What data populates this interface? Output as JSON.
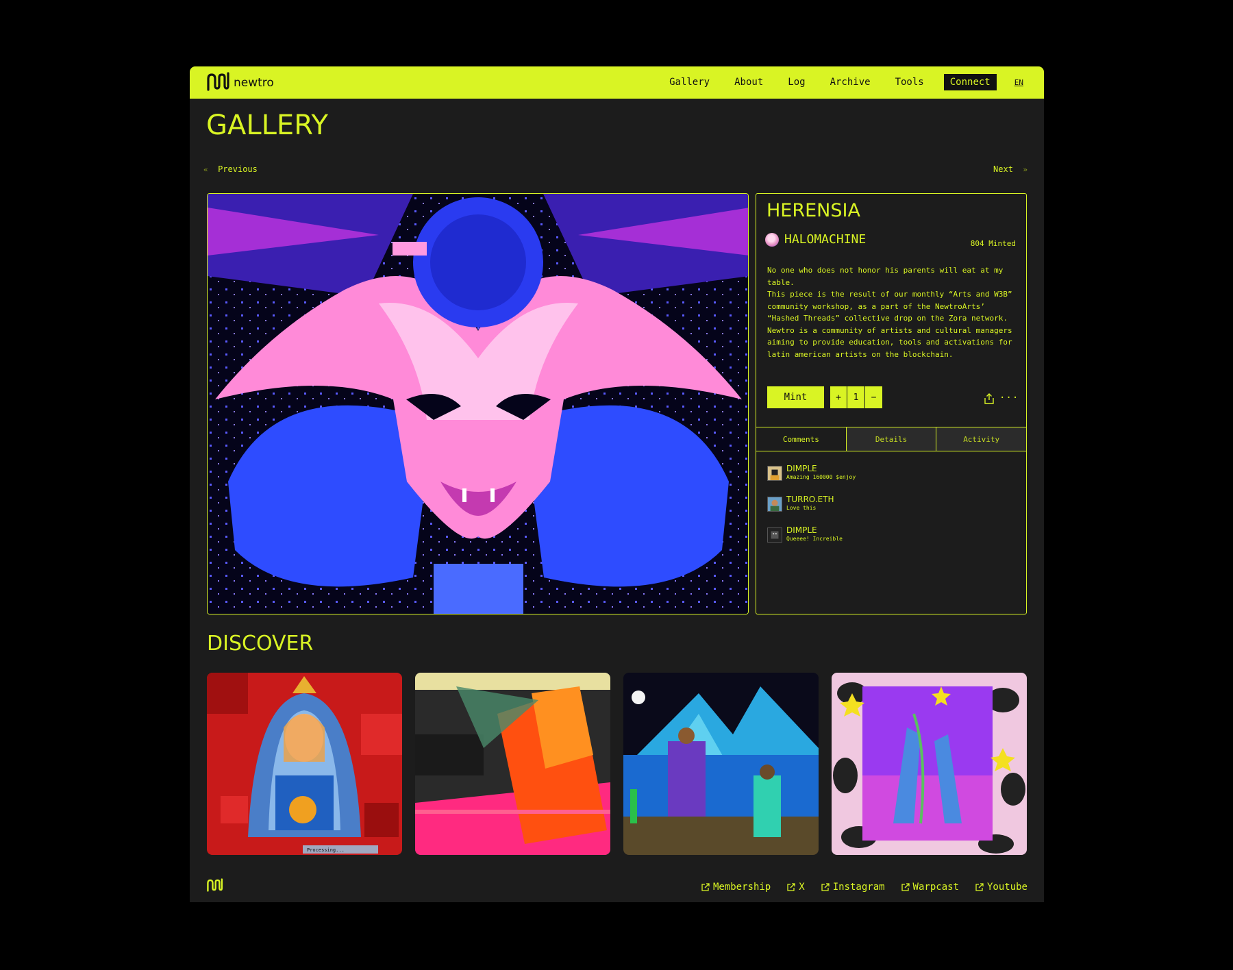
{
  "brand": {
    "name": "newtro"
  },
  "nav": {
    "items": [
      "Gallery",
      "About",
      "Log",
      "Archive",
      "Tools"
    ],
    "connect": "Connect",
    "lang": "EN"
  },
  "page": {
    "title": "GALLERY"
  },
  "pager": {
    "previous": "Previous",
    "next": "Next",
    "prev_glyph": "«",
    "next_glyph": "»"
  },
  "piece": {
    "title": "HERENSIA",
    "artist": "HALOMACHINE",
    "minted": "804 Minted",
    "description": [
      "No one who does not honor his parents will eat at my table.",
      "This piece is the result of our monthly “Arts and W3B” community workshop, as a part of the NewtroArts’ “Hashed Threads” collective drop on the Zora network.",
      "Newtro is a community of artists and cultural managers aiming to provide education, tools and activations for latin american artists on the blockchain."
    ],
    "mint_label": "Mint",
    "quantity": "1",
    "plus": "+",
    "minus": "−",
    "more": "···"
  },
  "tabs": [
    "Comments",
    "Details",
    "Activity"
  ],
  "comments": [
    {
      "user": "DIMPLE",
      "text": "Amazing 160000 $enjoy"
    },
    {
      "user": "TURRO.ETH",
      "text": "Love this"
    },
    {
      "user": "DIMPLE",
      "text": "Queeee! Increible"
    }
  ],
  "discover": {
    "title": "DISCOVER",
    "card1_caption": "Processing..."
  },
  "footer": {
    "links": [
      "Membership",
      "X",
      "Instagram",
      "Warpcast",
      "Youtube"
    ]
  },
  "colors": {
    "accent": "#d9f424",
    "background": "#1c1c1c",
    "page": "#000000"
  }
}
